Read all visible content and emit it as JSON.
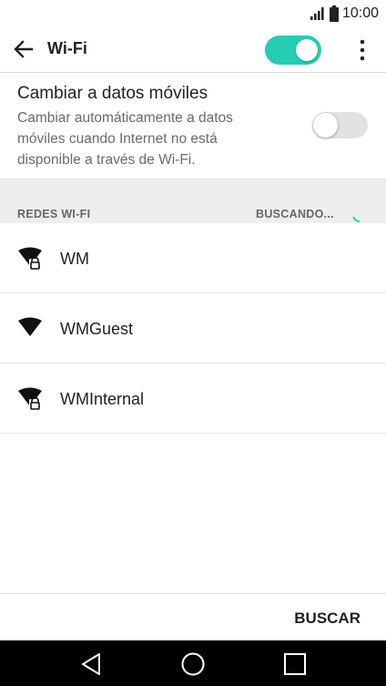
{
  "status_bar": {
    "time": "10:00",
    "icons": [
      "signal-icon",
      "battery-icon"
    ]
  },
  "app_bar": {
    "title": "Wi-Fi",
    "wifi_enabled": true,
    "accent_color": "#24cdb4"
  },
  "mobile_data_switch": {
    "title": "Cambiar a datos móviles",
    "description": "Cambiar automáticamente a datos móviles cuando Internet no está disponible a través de Wi-Fi.",
    "enabled": false
  },
  "networks_section": {
    "label": "REDES WI-FI",
    "status": "BUSCANDO..."
  },
  "networks": [
    {
      "name": "WM",
      "secured": true,
      "icon": "wifi-lock-icon"
    },
    {
      "name": "WMGuest",
      "secured": false,
      "icon": "wifi-icon"
    },
    {
      "name": "WMInternal",
      "secured": true,
      "icon": "wifi-lock-icon"
    }
  ],
  "bottom_bar": {
    "scan_label": "BUSCAR"
  },
  "nav_bar": {
    "buttons": [
      "back-icon",
      "home-icon",
      "recents-icon"
    ]
  }
}
